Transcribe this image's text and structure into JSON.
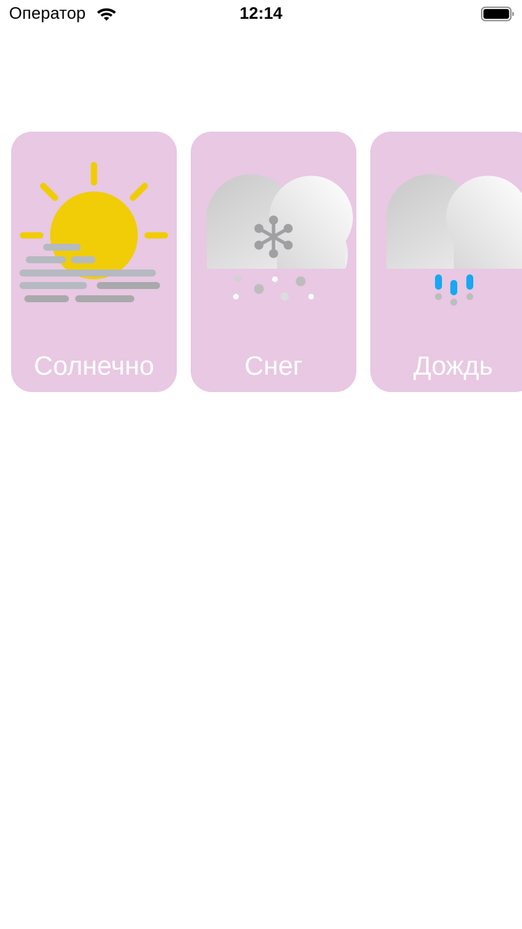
{
  "status_bar": {
    "carrier": "Оператор",
    "time": "12:14",
    "icons": [
      "wifi-icon",
      "battery-icon"
    ]
  },
  "theme": {
    "card_background": "#E8C8E2",
    "label_color": "#FFFFFF",
    "sun_color": "#F0CC00",
    "fog_color": "#B5BAC0",
    "rain_color": "#19A7F2",
    "snowflake_color": "#A0A0A2"
  },
  "cards": [
    {
      "label": "Солнечно",
      "icon": "sun-fog-icon"
    },
    {
      "label": "Снег",
      "icon": "cloud-snow-icon"
    },
    {
      "label": "Дождь",
      "icon": "cloud-rain-icon"
    }
  ]
}
